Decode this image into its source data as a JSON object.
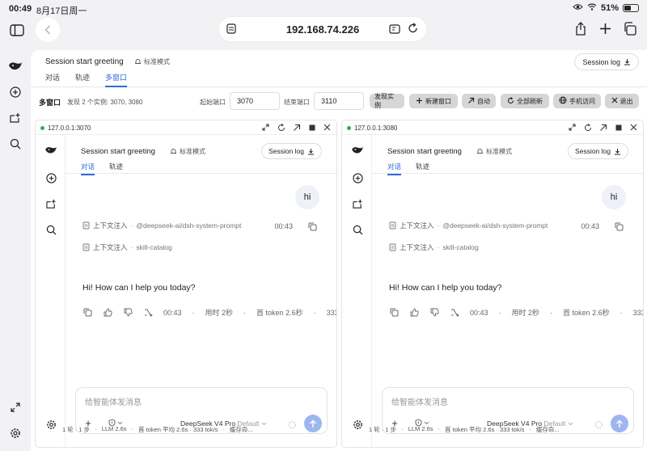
{
  "status": {
    "time": "00:49",
    "date": "8月17日周一",
    "battery": "51%",
    "battery_level": 0.51
  },
  "browser": {
    "url": "192.168.74.226"
  },
  "page": {
    "session_title": "Session start greeting",
    "mode": "标准模式",
    "tabs": [
      "对话",
      "轨迹",
      "多窗口"
    ],
    "active_tab": "多窗口",
    "session_log": "Session log"
  },
  "multiwindow": {
    "title": "多窗口",
    "found": "发现 2 个实例: 3070, 3080",
    "start_port_label": "起始端口",
    "start_port": "3070",
    "end_port_label": "结束端口",
    "end_port": "3110",
    "buttons": {
      "discover": "发现实例",
      "new_window": "新建窗口",
      "auto": "自动",
      "refresh_all": "全部刷新",
      "mobile": "手机访问",
      "exit": "退出"
    }
  },
  "panes": [
    {
      "url": "127.0.0.1:3070",
      "title": "Session start greeting",
      "mode": "标准模式",
      "session_log": "Session log",
      "tabs": [
        "对话",
        "轨迹"
      ],
      "user_message": "hi",
      "user_time": "00:43",
      "context_label": "上下文注入",
      "context_items": [
        "@deepseek-ai/dsh-system-prompt",
        "skill-catalog"
      ],
      "assistant_message": "Hi! How can I help you today?",
      "stats": {
        "time": "00:43",
        "duration": "用时 2秒",
        "first_token": "首 token 2.6秒",
        "rate": "333"
      },
      "composer_placeholder": "给智能体发消息",
      "model": "DeepSeek V4 Pro",
      "model_variant": "Default",
      "footer": [
        "1 轮 · 1 步",
        "LLM 2.6s",
        "首 token 平均 2.6s · 333 tok/s",
        "缓存命..."
      ]
    },
    {
      "url": "127.0.0.1:3080",
      "title": "Session start greeting",
      "mode": "标准模式",
      "session_log": "Session log",
      "tabs": [
        "对话",
        "轨迹"
      ],
      "user_message": "hi",
      "user_time": "00:43",
      "context_label": "上下文注入",
      "context_items": [
        "@deepseek-ai/dsh-system-prompt",
        "skill-catalog"
      ],
      "assistant_message": "Hi! How can I help you today?",
      "stats": {
        "time": "00:43",
        "duration": "用时 2秒",
        "first_token": "首 token 2.6秒",
        "rate": "333"
      },
      "composer_placeholder": "给智能体发消息",
      "model": "DeepSeek V4 Pro",
      "model_variant": "Default",
      "footer": [
        "1 轮 · 1 步",
        "LLM 2.6s",
        "首 token 平均 2.6s · 333 tok/s",
        "缓存命..."
      ]
    }
  ],
  "colors": {
    "accent": "#2f6bd9",
    "send_button": "#9db6ef",
    "online_dot": "#2bb14c"
  }
}
